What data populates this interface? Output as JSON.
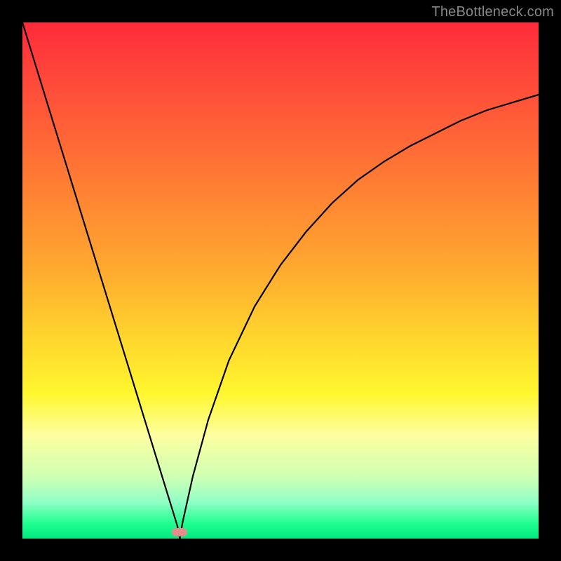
{
  "watermark": "TheBottleneck.com",
  "chart_data": {
    "type": "line",
    "title": "",
    "xlabel": "",
    "ylabel": "",
    "xlim": [
      0,
      1
    ],
    "ylim": [
      0,
      1
    ],
    "x": [
      0.0,
      0.02,
      0.04,
      0.06,
      0.08,
      0.1,
      0.12,
      0.14,
      0.16,
      0.18,
      0.2,
      0.22,
      0.24,
      0.26,
      0.28,
      0.3,
      0.305,
      0.31,
      0.33,
      0.36,
      0.4,
      0.45,
      0.5,
      0.55,
      0.6,
      0.65,
      0.7,
      0.75,
      0.8,
      0.85,
      0.9,
      0.95,
      1.0
    ],
    "values": [
      1.0,
      0.935,
      0.87,
      0.805,
      0.74,
      0.675,
      0.61,
      0.545,
      0.48,
      0.415,
      0.35,
      0.285,
      0.22,
      0.155,
      0.09,
      0.025,
      0.0,
      0.03,
      0.12,
      0.23,
      0.345,
      0.45,
      0.53,
      0.595,
      0.65,
      0.695,
      0.73,
      0.76,
      0.785,
      0.81,
      0.83,
      0.845,
      0.86
    ],
    "marker": {
      "x": 0.305,
      "y": 0.012
    }
  }
}
